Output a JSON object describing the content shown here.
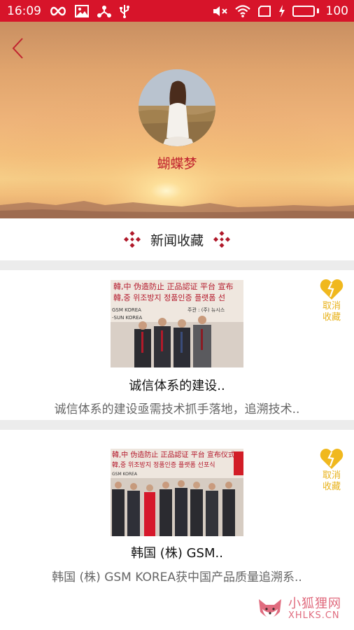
{
  "status_bar": {
    "time": "16:09",
    "battery_percent": "100",
    "battery_level": 1.0
  },
  "header": {
    "username": "蝴蝶梦"
  },
  "section": {
    "title": "新闻收藏"
  },
  "favorites": [
    {
      "title": "诚信体系的建设..",
      "description": "诚信体系的建设亟需技术抓手落地，追溯技术..",
      "image_text": {
        "line1": "韓,中 伪造防止 正品認证  平台 宣布",
        "line2": "韓,중 위조방지 정품인증 플랫폼 선",
        "line3": "GSM KOREA",
        "line4": "-SUN KOREA",
        "line5": "주관 : (주) 뉴시스"
      },
      "unfav_line1": "取消",
      "unfav_line2": "收藏"
    },
    {
      "title": "韩国 (株) GSM..",
      "description": "韩国 (株) GSM KOREA获中国产品质量追溯系..",
      "image_text": {
        "line1": "韓,中 伪造防止 正品認证  平台 宣布仪式",
        "line2": "韓,중 위조방지 정품인증 플랫폼 선포식",
        "line3": "GSM KOREA"
      },
      "unfav_line1": "取消",
      "unfav_line2": "收藏"
    }
  ],
  "watermark": {
    "chinese": "小狐狸网",
    "domain": "XHLKS.CN"
  },
  "colors": {
    "status_bar": "#d7142a",
    "username": "#c0222e",
    "unfav_icon": "#f0b81e",
    "section_ornament": "#b0192a",
    "watermark": "#e06b7e"
  }
}
